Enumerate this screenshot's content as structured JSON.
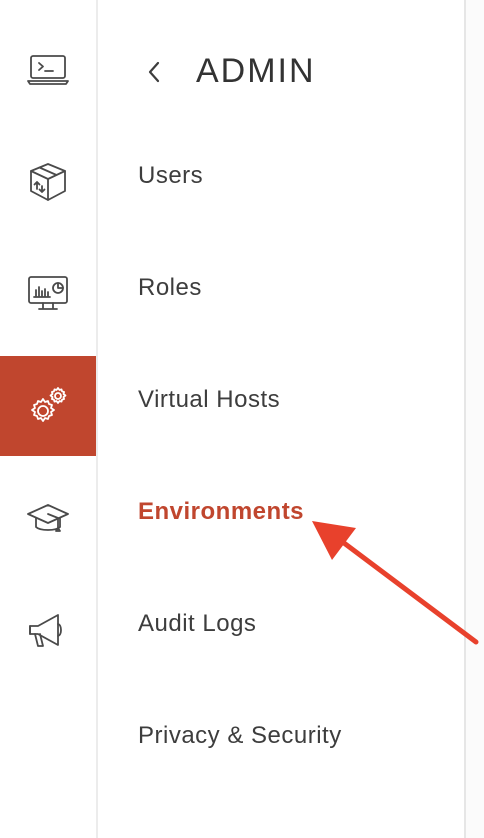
{
  "colors": {
    "accent": "#c0462e",
    "icon_stroke": "#4a4a4a",
    "text": "#3d3d3d",
    "arrow": "#e8412c"
  },
  "rail": {
    "items": [
      {
        "icon": "terminal-laptop-icon",
        "active": false
      },
      {
        "icon": "package-box-icon",
        "active": false
      },
      {
        "icon": "monitor-dashboard-icon",
        "active": false
      },
      {
        "icon": "gears-settings-icon",
        "active": true
      },
      {
        "icon": "graduation-cap-icon",
        "active": false
      },
      {
        "icon": "megaphone-icon",
        "active": false
      }
    ]
  },
  "header": {
    "back_icon": "chevron-left-icon",
    "title": "ADMIN"
  },
  "menu": {
    "items": [
      {
        "label": "Users",
        "active": false
      },
      {
        "label": "Roles",
        "active": false
      },
      {
        "label": "Virtual Hosts",
        "active": false
      },
      {
        "label": "Environments",
        "active": true
      },
      {
        "label": "Audit Logs",
        "active": false
      },
      {
        "label": "Privacy & Security",
        "active": false
      }
    ]
  },
  "annotation": {
    "icon": "red-arrow-pointer",
    "points_to": "Environments"
  }
}
